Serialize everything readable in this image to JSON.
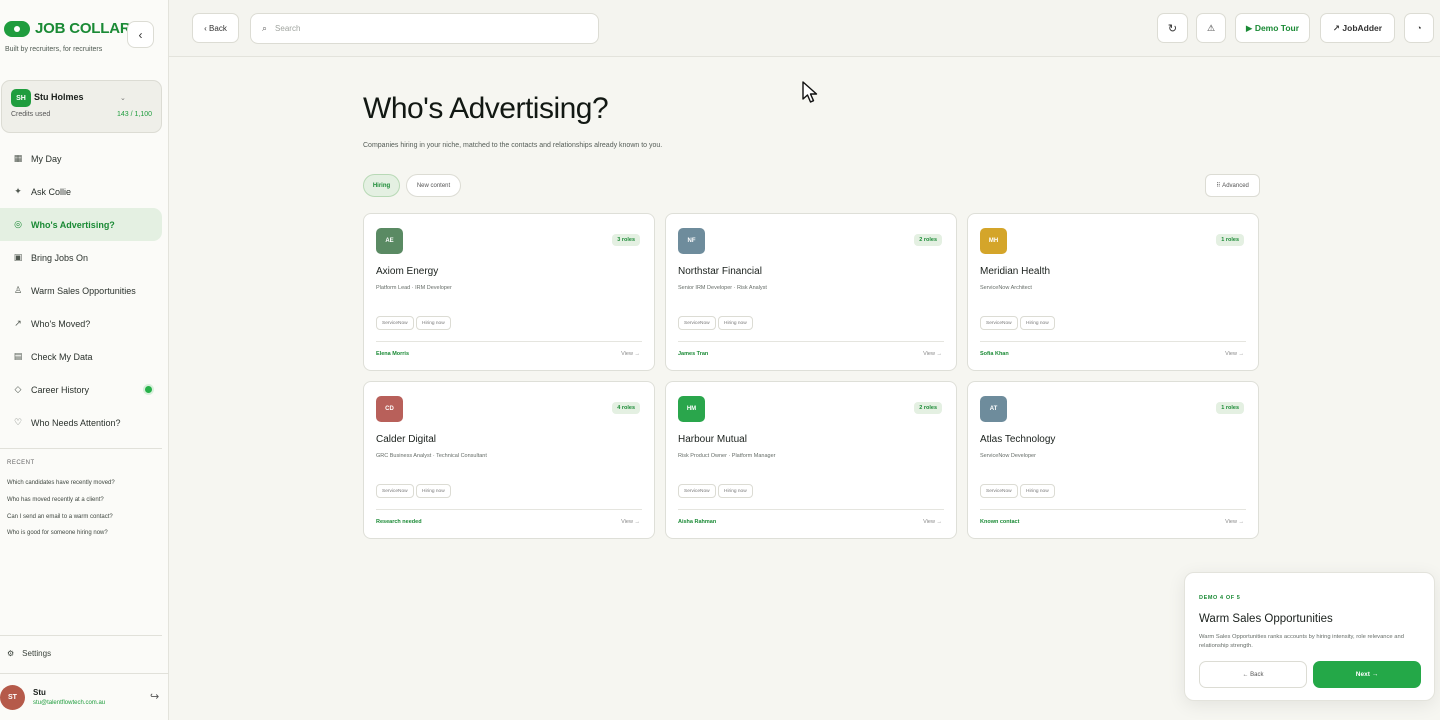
{
  "brand": {
    "name": "JOB COLLAR",
    "tagline": "Built by recruiters, for recruiters",
    "collapse_icon": "‹"
  },
  "user_card": {
    "initials": "SH",
    "name": "Stu Holmes",
    "credits_label": "Credits used",
    "credits_value": "143 / 1,100",
    "chevron": "⌄"
  },
  "nav": [
    {
      "icon": "▦",
      "label": "My Day",
      "active": false
    },
    {
      "icon": "✦",
      "label": "Ask Collie",
      "active": false
    },
    {
      "icon": "◎",
      "label": "Who's Advertising?",
      "active": true
    },
    {
      "icon": "▣",
      "label": "Bring Jobs On",
      "active": false
    },
    {
      "icon": "♙",
      "label": "Warm Sales Opportunities",
      "active": false
    },
    {
      "icon": "↗",
      "label": "Who's Moved?",
      "active": false
    },
    {
      "icon": "▤",
      "label": "Check My Data",
      "active": false
    },
    {
      "icon": "◇",
      "label": "Career History",
      "active": false,
      "dot": true
    },
    {
      "icon": "♡",
      "label": "Who Needs Attention?",
      "active": false
    }
  ],
  "recent": {
    "heading": "RECENT",
    "items": [
      "Which candidates have recently moved?",
      "Who has moved recently at a client?",
      "Can I send an email to a warm contact?",
      "Who is good for someone hiring now?"
    ]
  },
  "settings": {
    "icon": "⚙",
    "label": "Settings"
  },
  "footer_user": {
    "initials": "ST",
    "name": "Stu",
    "email": "stu@talentflowtech.com.au",
    "logout_icon": "↪"
  },
  "topbar": {
    "back_label": "‹  Back",
    "search_placeholder": "Search",
    "search_icon": "⌕",
    "refresh_icon": "↻",
    "alert_icon": "⚠",
    "demo_tour_label": "▶ Demo Tour",
    "jobadder_label": "↗  JobAdder",
    "last_icon": "◔"
  },
  "page": {
    "title": "Who's Advertising?",
    "subtitle": "Companies hiring in your niche, matched to the contacts and relationships already known to you.",
    "chips": [
      "Hiring",
      "New content"
    ],
    "advanced_label": "⠿ Advanced"
  },
  "cards": [
    {
      "initials": "AE",
      "color": "#5a8a63",
      "badge": "3 roles",
      "name": "Axiom Energy",
      "roles": "Platform Lead · IRM Developer",
      "tags": [
        "ServiceNow",
        "Hiring now"
      ],
      "contact": "Elena Morris",
      "view": "View →"
    },
    {
      "initials": "NF",
      "color": "#6e8c9c",
      "badge": "2 roles",
      "name": "Northstar Financial",
      "roles": "Senior IRM Developer · Risk Analyst",
      "tags": [
        "ServiceNow",
        "Hiring now"
      ],
      "contact": "James Tran",
      "view": "View →"
    },
    {
      "initials": "MH",
      "color": "#d4a52a",
      "badge": "1 roles",
      "name": "Meridian Health",
      "roles": "ServiceNow Architect",
      "tags": [
        "ServiceNow",
        "Hiring now"
      ],
      "contact": "Sofia Khan",
      "view": "View →"
    },
    {
      "initials": "CD",
      "color": "#b8605a",
      "badge": "4 roles",
      "name": "Calder Digital",
      "roles": "GRC Business Analyst · Technical Consultant",
      "tags": [
        "ServiceNow",
        "Hiring now"
      ],
      "contact": "Research needed",
      "view": "View →"
    },
    {
      "initials": "HM",
      "color": "#2aa64c",
      "badge": "2 roles",
      "name": "Harbour Mutual",
      "roles": "Risk Product Owner · Platform Manager",
      "tags": [
        "ServiceNow",
        "Hiring now"
      ],
      "contact": "Aisha Rahman",
      "view": "View →"
    },
    {
      "initials": "AT",
      "color": "#6e8c9c",
      "badge": "1 roles",
      "name": "Atlas Technology",
      "roles": "ServiceNow Developer",
      "tags": [
        "ServiceNow",
        "Hiring now"
      ],
      "contact": "Known contact",
      "view": "View →"
    }
  ],
  "demo": {
    "step": "DEMO 4 OF 5",
    "title": "Warm Sales Opportunities",
    "description": "Warm Sales Opportunities ranks accounts by hiring intensity, role relevance and relationship strength.",
    "back_label": "← Back",
    "next_label": "Next →"
  }
}
